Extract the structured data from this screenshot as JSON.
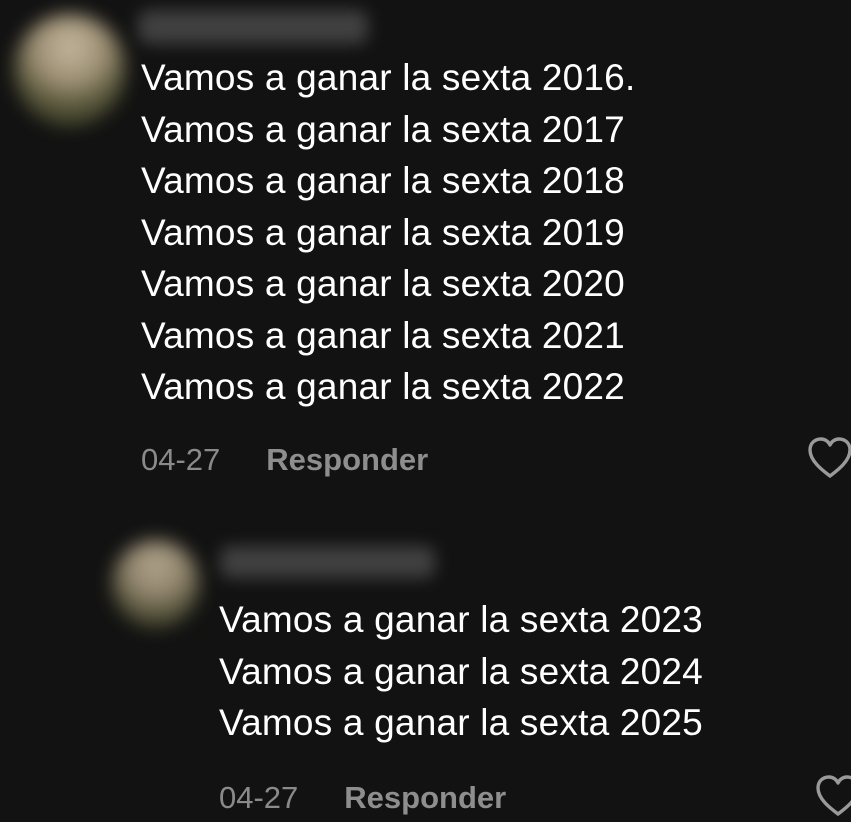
{
  "comment": {
    "lines": [
      "Vamos a ganar la sexta 2016.",
      "Vamos a ganar la sexta 2017",
      "Vamos a ganar la sexta 2018",
      "Vamos a ganar la sexta 2019",
      "Vamos a ganar la sexta 2020",
      "Vamos a ganar la sexta 2021",
      "Vamos a ganar la sexta 2022"
    ],
    "date": "04-27",
    "reply_label": "Responder",
    "like_icon": "heart-outline-icon"
  },
  "reply": {
    "lines": [
      "Vamos a ganar la sexta 2023",
      "Vamos a ganar la sexta 2024",
      "Vamos a ganar la sexta 2025"
    ],
    "date": "04-27",
    "reply_label": "Responder",
    "like_icon": "heart-outline-icon"
  },
  "colors": {
    "background": "#121212",
    "text": "#ffffff",
    "meta": "#8a8a8a",
    "icon": "#9a9a9a"
  }
}
